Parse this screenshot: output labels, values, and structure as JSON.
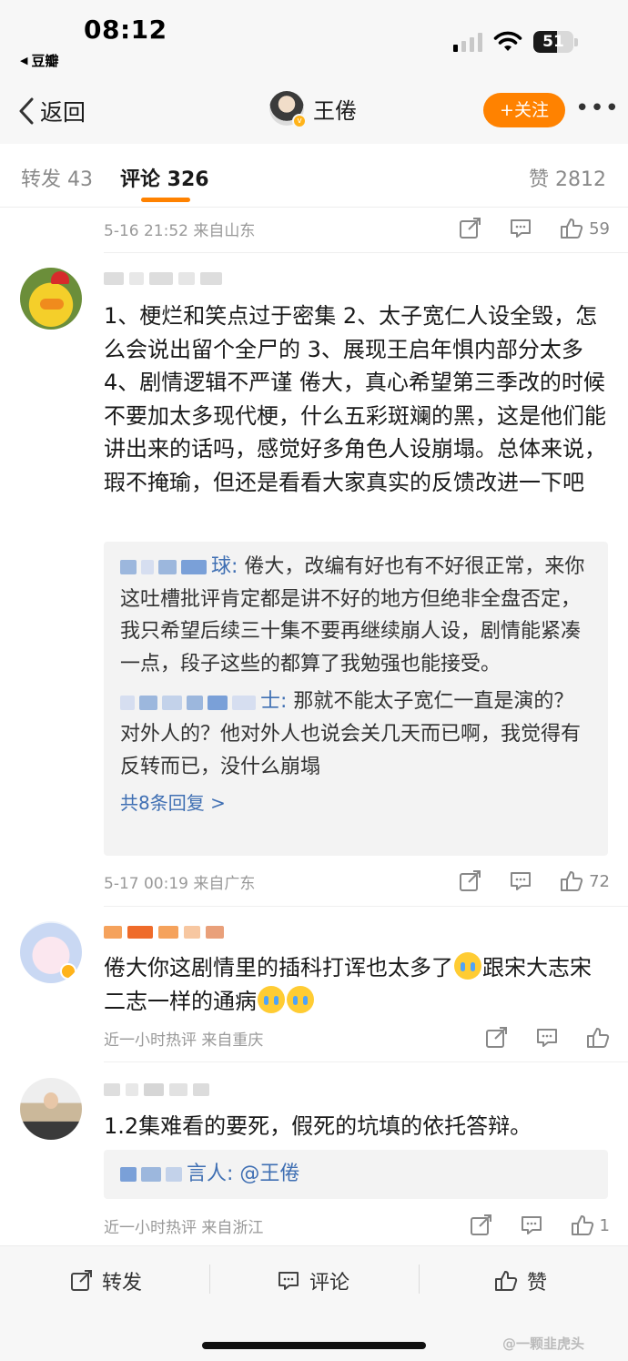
{
  "status": {
    "time": "08:12",
    "back_app": "豆瓣",
    "battery": "51"
  },
  "nav": {
    "back_label": "返回",
    "name": "王倦",
    "follow_label": "+关注",
    "more": "•••"
  },
  "tabs": {
    "repost": "转发 43",
    "comment": "评论 326",
    "like": "赞 2812"
  },
  "top_meta": {
    "text": "5-16 21:52 来自山东",
    "likes": "59"
  },
  "comments": [
    {
      "text": "1、梗烂和笑点过于密集 2、太子宽仁人设全毁，怎么会说出留个全尸的 3、展现王启年惧内部分太多 4、剧情逻辑不严谨 倦大，真心希望第三季改的时候不要加太多现代梗，什么五彩斑斓的黑，这是他们能讲出来的话吗，感觉好多角色人设崩塌。总体来说，瑕不掩瑜，但还是看看大家真实的反馈改进一下吧",
      "replies": [
        {
          "author_tail": "球:",
          "text": " 倦大，改编有好也有不好很正常，来你这吐槽批评肯定都是讲不好的地方但绝非全盘否定，我只希望后续三十集不要再继续崩人设，剧情能紧凑一点，段子这些的都算了我勉强也能接受。"
        },
        {
          "author_tail": "士:",
          "text": " 那就不能太子宽仁一直是演的？对外人的？他对外人也说会关几天而已啊，我觉得有反转而已，没什么崩塌"
        }
      ],
      "more_replies": "共8条回复 >",
      "meta": "5-17 00:19 来自广东",
      "likes": "72"
    },
    {
      "text_a": "倦大你这剧情里的插科打诨也太多了",
      "text_b": "跟宋大志宋二志一样的通病",
      "meta": "近一小时热评 来自重庆",
      "likes": ""
    },
    {
      "text": "1.2集难看的要死，假死的坑填的依托答辩。",
      "reply_author_tail": "言人:",
      "reply_mention": "@王倦",
      "meta": "近一小时热评 来自浙江",
      "likes": "1"
    }
  ],
  "bottom": {
    "repost": "转发",
    "comment": "评论",
    "like": "赞"
  },
  "watermark": "@一颗韭虎头",
  "colors": {
    "accent": "#ff8200",
    "link": "#3f6fb3",
    "meta": "#999999"
  }
}
